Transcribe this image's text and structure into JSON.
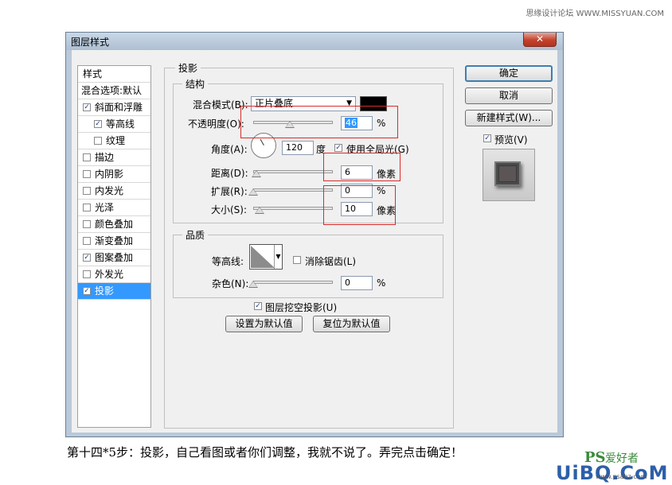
{
  "watermark_top": "思缘设计论坛 WWW.MISSYUAN.COM",
  "dialog": {
    "title": "图层样式",
    "close_symbol": "✕"
  },
  "styles_list": {
    "header": "样式",
    "blend_options": "混合选项:默认",
    "items": [
      {
        "label": "斜面和浮雕",
        "checked": true
      },
      {
        "label": "等高线",
        "checked": true
      },
      {
        "label": "纹理",
        "checked": false
      },
      {
        "label": "描边",
        "checked": false
      },
      {
        "label": "内阴影",
        "checked": false
      },
      {
        "label": "内发光",
        "checked": false
      },
      {
        "label": "光泽",
        "checked": false
      },
      {
        "label": "颜色叠加",
        "checked": false
      },
      {
        "label": "渐变叠加",
        "checked": false
      },
      {
        "label": "图案叠加",
        "checked": true
      },
      {
        "label": "外发光",
        "checked": false
      },
      {
        "label": "投影",
        "checked": true
      }
    ]
  },
  "drop_shadow": {
    "section": "投影",
    "structure": {
      "title": "结构",
      "blend_mode_label": "混合模式(B):",
      "blend_mode_value": "正片叠底",
      "blend_color": "#000000",
      "opacity_label": "不透明度(O):",
      "opacity_value": "46",
      "opacity_unit": "%",
      "angle_label": "角度(A):",
      "angle_value": "120",
      "angle_unit": "度",
      "global_light_label": "使用全局光(G)",
      "distance_label": "距离(D):",
      "distance_value": "6",
      "distance_unit": "像素",
      "spread_label": "扩展(R):",
      "spread_value": "0",
      "spread_unit": "%",
      "size_label": "大小(S):",
      "size_value": "10",
      "size_unit": "像素"
    },
    "quality": {
      "title": "品质",
      "contour_label": "等高线:",
      "antialias_label": "消除锯齿(L)",
      "noise_label": "杂色(N):",
      "noise_value": "0",
      "noise_unit": "%"
    },
    "knockout_label": "图层挖空投影(U)",
    "make_default": "设置为默认值",
    "reset_default": "复位为默认值"
  },
  "buttons": {
    "ok": "确定",
    "cancel": "取消",
    "new_style": "新建样式(W)...",
    "preview": "预览(V)"
  },
  "colors": {
    "selection": "#3399ff",
    "highlight_box": "#d92b2b"
  },
  "caption": "第十四*5步：投影，自己看图或者你们调整，我就不说了。弄完点击确定！",
  "logo": {
    "ps": "PS",
    "cn": "爱好者",
    "brand": "UiBQ.CoM",
    "sub": "www.psahz.com"
  }
}
